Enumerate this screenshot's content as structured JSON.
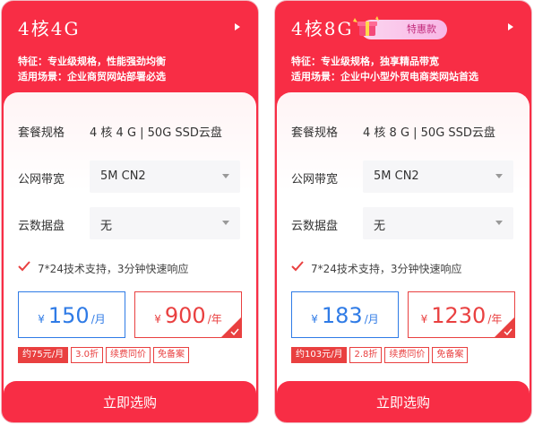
{
  "plans": [
    {
      "title": "4核4G",
      "promo": "",
      "feature": "特征：专业级规格，性能强劲均衡",
      "scenario": "适用场景：企业商贸网站部署必选",
      "spec_label": "套餐规格",
      "spec_value": "4 核 4 G | 50G SSD云盘",
      "bandwidth_label": "公网带宽",
      "bandwidth_value": "5M CN2",
      "disk_label": "云数据盘",
      "disk_value": "无",
      "support": "7*24技术支持，3分钟快速响应",
      "currency": "¥",
      "month_price": "150",
      "month_unit": "/月",
      "year_price": "900",
      "year_unit": "/年",
      "tags": [
        "约75元/月",
        "3.0折",
        "续费同价",
        "免备案"
      ],
      "buy_label": "立即选购"
    },
    {
      "title": "4核8G",
      "promo": "特惠款",
      "feature": "特征：专业级规格，独享精品带宽",
      "scenario": "适用场景：企业中小型外贸电商类网站首选",
      "spec_label": "套餐规格",
      "spec_value": "4 核 8 G | 50G SSD云盘",
      "bandwidth_label": "公网带宽",
      "bandwidth_value": "5M CN2",
      "disk_label": "云数据盘",
      "disk_value": "无",
      "support": "7*24技术支持，3分钟快速响应",
      "currency": "¥",
      "month_price": "183",
      "month_unit": "/月",
      "year_price": "1230",
      "year_unit": "/年",
      "tags": [
        "约103元/月",
        "2.8折",
        "续费同价",
        "免备案"
      ],
      "buy_label": "立即选购"
    }
  ],
  "colors": {
    "brand": "#f82d45",
    "month_accent": "#2f7be6",
    "year_accent": "#e94040"
  },
  "icons": [
    "chevron-right-icon",
    "checkmark-icon",
    "gift-icon",
    "corner-check-icon",
    "chevron-down-icon"
  ]
}
